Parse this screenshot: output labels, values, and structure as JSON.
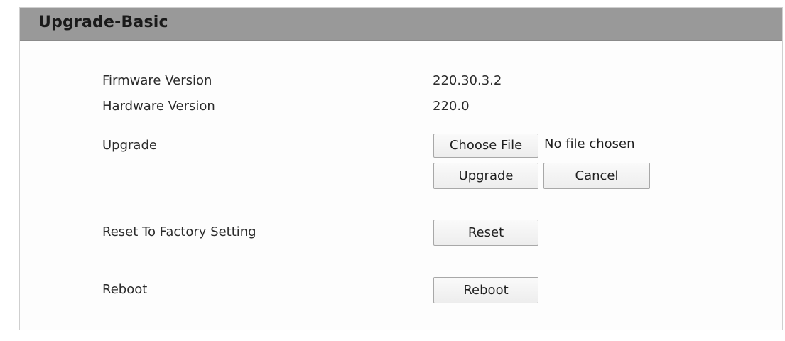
{
  "panel": {
    "title": "Upgrade-Basic"
  },
  "info": {
    "firmware_label": "Firmware Version",
    "firmware_value": "220.30.3.2",
    "hardware_label": "Hardware Version",
    "hardware_value": "220.0"
  },
  "upgrade": {
    "label": "Upgrade",
    "choose_file_label": "Choose File",
    "file_status": "No file chosen",
    "upgrade_button": "Upgrade",
    "cancel_button": "Cancel"
  },
  "reset": {
    "label": "Reset To Factory Setting",
    "button": "Reset"
  },
  "reboot": {
    "label": "Reboot",
    "button": "Reboot"
  }
}
